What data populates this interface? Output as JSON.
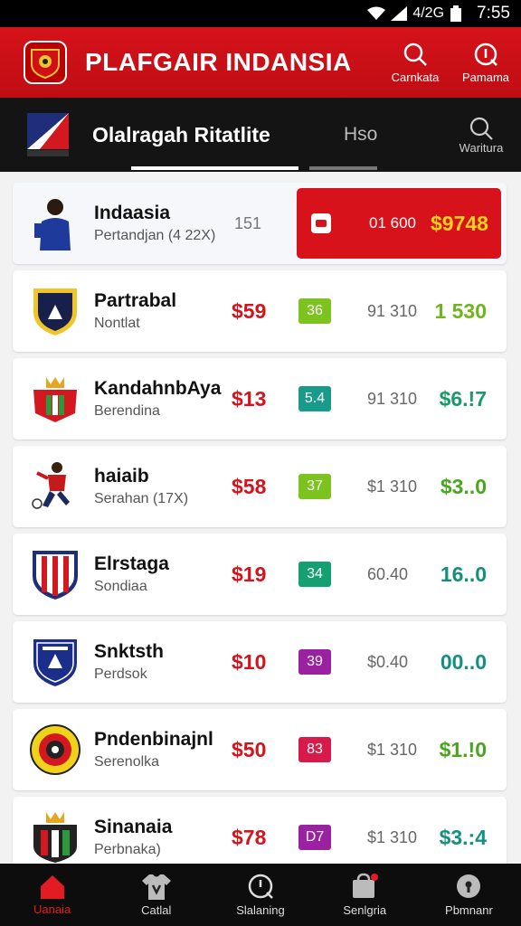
{
  "status_bar": {
    "time": "7:55",
    "network": "4/2G"
  },
  "header": {
    "title": "PLAFGAIR INDANSIA",
    "buttons": [
      {
        "label": "Carnkata",
        "icon": "search-icon"
      },
      {
        "label": "Pamama",
        "icon": "info-icon"
      }
    ]
  },
  "section": {
    "title": "Olalragah Ritatlite",
    "alt_tab": "Hso",
    "more_label": "Waritura"
  },
  "rows": [
    {
      "name": "Indaasia",
      "sub": "Pertandjan (4 22X)",
      "count": "151",
      "highlight_mid": "01 600",
      "highlight_value": "$9748",
      "crest": "player"
    },
    {
      "name": "Partrabal",
      "sub": "Nontlat",
      "price": "$59",
      "badge": "36",
      "badge_color": "#7cc320",
      "mid": "91 310",
      "change": "1 530",
      "change_color": "#6fb51d",
      "crest": "shield-navy"
    },
    {
      "name": "KandahnbAya",
      "sub": "Berendina",
      "price": "$13",
      "badge": "5.4",
      "badge_color": "#1a9a8a",
      "mid": "91 310",
      "change": "$6.!7",
      "change_color": "#1a9a6a",
      "crest": "crown-red"
    },
    {
      "name": "haiaib",
      "sub": "Serahan (17X)",
      "price": "$58",
      "badge": "37",
      "badge_color": "#7cc320",
      "mid": "$1 310",
      "change": "$3..0",
      "change_color": "#4aa51d",
      "crest": "footballer"
    },
    {
      "name": "Elrstaga",
      "sub": "Sondiaa",
      "price": "$19",
      "badge": "34",
      "badge_color": "#14a070",
      "mid": "60.40",
      "change": "16..0",
      "change_color": "#139077",
      "crest": "stripes-red"
    },
    {
      "name": "Snktsth",
      "sub": "Perdsok",
      "price": "$10",
      "badge": "39",
      "badge_color": "#9a22a0",
      "mid": "$0.40",
      "change": "00..0",
      "change_color": "#149080",
      "crest": "shield-blue"
    },
    {
      "name": "Pndenbinajnl",
      "sub": "Serenolka",
      "price": "$50",
      "badge": "83",
      "badge_color": "#d81a4a",
      "mid": "$1 310",
      "change": "$1.!0",
      "change_color": "#4aa51d",
      "crest": "round-yellow"
    },
    {
      "name": "Sinanaia",
      "sub": "Perbnaka)",
      "price": "$78",
      "badge": "D7",
      "badge_color": "#9a22a0",
      "mid": "$1 310",
      "change": "$3.:4",
      "change_color": "#149080",
      "crest": "crown-flag"
    }
  ],
  "nav": [
    {
      "label": "Uanaia",
      "icon": "home-icon",
      "active": true
    },
    {
      "label": "Catlal",
      "icon": "jersey-icon",
      "active": false
    },
    {
      "label": "Slalaning",
      "icon": "clock-icon",
      "active": false
    },
    {
      "label": "Senlgria",
      "icon": "bag-icon",
      "active": false
    },
    {
      "label": "Pbmnanr",
      "icon": "lock-icon",
      "active": false
    }
  ]
}
